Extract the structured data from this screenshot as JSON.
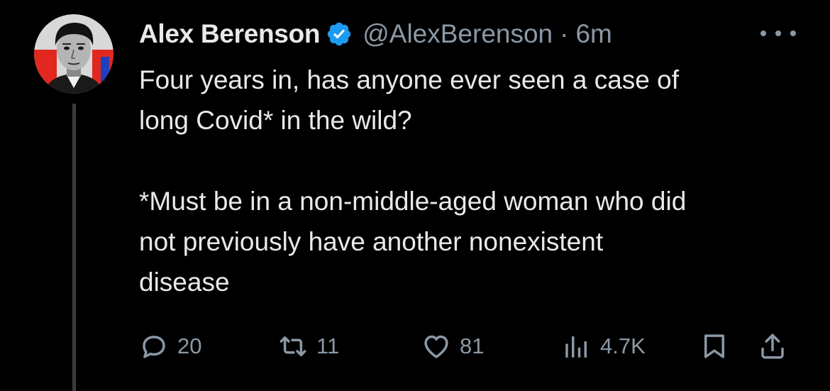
{
  "tweet": {
    "author": {
      "name": "Alex Berenson",
      "handle": "@AlexBerenson",
      "verified": true
    },
    "separator": "·",
    "timestamp": "6m",
    "body": {
      "line1": "Four years in, has anyone ever seen a case of",
      "line2": "long Covid* in the wild?",
      "line3": "*Must be in a non-middle-aged woman who did",
      "line4": "not previously have another nonexistent",
      "line5": "disease"
    },
    "actions": {
      "replies": "20",
      "reposts": "11",
      "likes": "81",
      "views": "4.7K"
    }
  },
  "icons": {
    "verified": "verified-badge-icon",
    "more": "more-options-icon",
    "reply": "reply-icon",
    "repost": "repost-icon",
    "like": "heart-icon",
    "views": "views-icon",
    "bookmark": "bookmark-icon",
    "share": "share-icon"
  },
  "colors": {
    "background": "#000000",
    "text": "#e7e9ea",
    "secondary": "#8b98a5",
    "verified": "#1d9bf0",
    "thread_line": "#3a3b3c"
  }
}
